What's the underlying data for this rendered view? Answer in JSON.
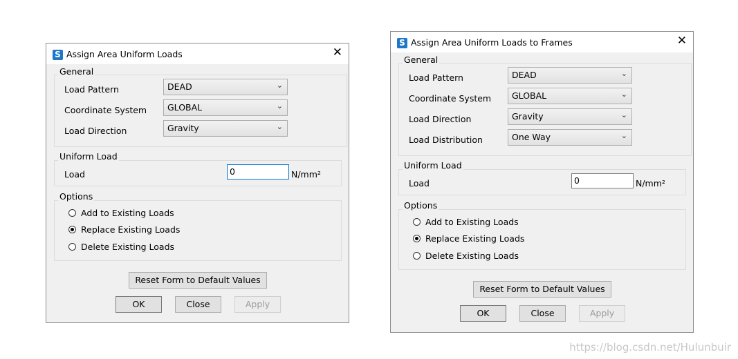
{
  "dialog1": {
    "title": "Assign Area Uniform Loads",
    "app_icon_letter": "S",
    "close_glyph": "✕",
    "general": {
      "title": "General",
      "load_pattern_label": "Load Pattern",
      "load_pattern_value": "DEAD",
      "coordinate_system_label": "Coordinate System",
      "coordinate_system_value": "GLOBAL",
      "load_direction_label": "Load Direction",
      "load_direction_value": "Gravity"
    },
    "uniform_load": {
      "title": "Uniform Load",
      "load_label": "Load",
      "load_value": "0",
      "unit": "N/mm²"
    },
    "options": {
      "title": "Options",
      "add": "Add to Existing Loads",
      "replace": "Replace Existing Loads",
      "delete": "Delete Existing Loads",
      "selected": "replace"
    },
    "buttons": {
      "reset": "Reset Form to Default Values",
      "ok": "OK",
      "close": "Close",
      "apply": "Apply"
    }
  },
  "dialog2": {
    "title": "Assign Area Uniform Loads to Frames",
    "app_icon_letter": "S",
    "close_glyph": "✕",
    "general": {
      "title": "General",
      "load_pattern_label": "Load Pattern",
      "load_pattern_value": "DEAD",
      "coordinate_system_label": "Coordinate System",
      "coordinate_system_value": "GLOBAL",
      "load_direction_label": "Load Direction",
      "load_direction_value": "Gravity",
      "load_distribution_label": "Load Distribution",
      "load_distribution_value": "One Way"
    },
    "uniform_load": {
      "title": "Uniform Load",
      "load_label": "Load",
      "load_value": "0",
      "unit": "N/mm²"
    },
    "options": {
      "title": "Options",
      "add": "Add to Existing Loads",
      "replace": "Replace Existing Loads",
      "delete": "Delete Existing Loads",
      "selected": "replace"
    },
    "buttons": {
      "reset": "Reset Form to Default Values",
      "ok": "OK",
      "close": "Close",
      "apply": "Apply"
    }
  },
  "watermark": "https://blog.csdn.net/Hulunbuir",
  "colors": {
    "dialog_bg": "#f0f0f0",
    "app_icon": "#1e78c8",
    "focus_border": "#0078d7"
  }
}
